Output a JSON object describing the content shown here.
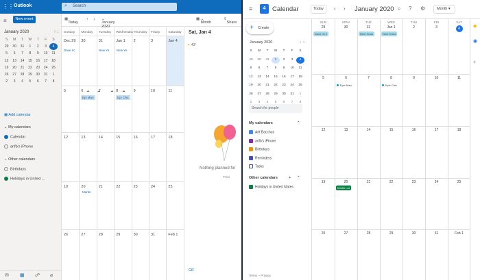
{
  "outlook": {
    "brand": "Outlook",
    "search_placeholder": "Search",
    "new_event": "New event",
    "toolbar": {
      "today": "Today",
      "month_label": "January 2020",
      "view": "Month",
      "share": "Share"
    },
    "mini_month": "January 2020",
    "mini_dow": [
      "S",
      "M",
      "T",
      "W",
      "T",
      "F",
      "S"
    ],
    "mini_weeks": [
      [
        "29",
        "30",
        "31",
        "1",
        "2",
        "3",
        "4"
      ],
      [
        "5",
        "6",
        "7",
        "8",
        "9",
        "10",
        "11"
      ],
      [
        "12",
        "13",
        "14",
        "15",
        "16",
        "17",
        "18"
      ],
      [
        "19",
        "20",
        "21",
        "22",
        "23",
        "24",
        "25"
      ],
      [
        "26",
        "27",
        "28",
        "29",
        "30",
        "31",
        "1"
      ],
      [
        "2",
        "3",
        "4",
        "5",
        "6",
        "7",
        "8"
      ]
    ],
    "add_calendar": "Add calendar",
    "my_calendars": "My calendars",
    "my_items": [
      "Calendar",
      "arifb's iPhone"
    ],
    "other_calendars": "Other calendars",
    "other_items": [
      "Birthdays",
      "Holidays in United ..."
    ],
    "grid_dow": [
      "Sunday",
      "Monday",
      "Tuesday",
      "Wednesday",
      "Thursday",
      "Friday",
      "Saturday"
    ],
    "week_rows": [
      [
        "Dec 29",
        "30",
        "31",
        "Jan 1",
        "2",
        "3",
        "Jan 4"
      ],
      [
        "5",
        "6",
        "7",
        "8",
        "9",
        "10",
        "11"
      ],
      [
        "12",
        "13",
        "14",
        "15",
        "16",
        "17",
        "18"
      ],
      [
        "19",
        "20",
        "21",
        "22",
        "23",
        "24",
        "25"
      ],
      [
        "26",
        "27",
        "28",
        "29",
        "30",
        "31",
        "Feb 1"
      ]
    ],
    "events": {
      "dave": "Dave ric",
      "newyear_tue": "New Ye",
      "newyear_wed": "New Ye",
      "epi_mon": "Epi Man",
      "epi_wed": "Epi Chic",
      "martin": "Martin"
    },
    "agenda": {
      "title": "Sat, Jan 4",
      "weather": "43°",
      "nothing": "Nothing planned for",
      "prev": "Previ",
      "gif": "GIF"
    }
  },
  "gcal": {
    "title": "Calendar",
    "logo_num": "4",
    "today": "Today",
    "month_title": "January 2020",
    "view": "Month",
    "create": "Create",
    "mini_month": "January 2020",
    "mini_dow": [
      "S",
      "M",
      "T",
      "W",
      "T",
      "F",
      "S"
    ],
    "mini_weeks": [
      [
        "29",
        "30",
        "31",
        "1",
        "2",
        "3",
        "4"
      ],
      [
        "5",
        "6",
        "7",
        "8",
        "9",
        "10",
        "11"
      ],
      [
        "12",
        "13",
        "14",
        "15",
        "16",
        "17",
        "18"
      ],
      [
        "19",
        "20",
        "21",
        "22",
        "23",
        "24",
        "25"
      ],
      [
        "26",
        "27",
        "28",
        "29",
        "30",
        "31",
        "1"
      ],
      [
        "2",
        "3",
        "4",
        "5",
        "6",
        "7",
        "8"
      ]
    ],
    "search_people": "Search for people",
    "my_calendars": "My calendars",
    "my_items": [
      {
        "label": "Arif Bacchus",
        "color": "#4285f4"
      },
      {
        "label": "arifb's iPhone",
        "color": "#8e24aa"
      },
      {
        "label": "Birthdays",
        "color": "#f09300"
      },
      {
        "label": "Reminders",
        "color": "#3f51b5"
      },
      {
        "label": "Tasks",
        "color": "#ffffff"
      }
    ],
    "other_calendars": "Other calendars",
    "other_items": [
      {
        "label": "Holidays in United States",
        "color": "#0b8043"
      }
    ],
    "footer": "Terms – Privacy",
    "dow": [
      "SUN",
      "MON",
      "TUE",
      "WED",
      "THU",
      "FRI",
      "SAT"
    ],
    "week_rows": [
      [
        "29",
        "30",
        "31",
        "Jan 1",
        "2",
        "3",
        "4"
      ],
      [
        "5",
        "6",
        "7",
        "8",
        "9",
        "10",
        "11"
      ],
      [
        "12",
        "13",
        "14",
        "15",
        "16",
        "17",
        "18"
      ],
      [
        "19",
        "20",
        "21",
        "22",
        "23",
        "24",
        "25"
      ],
      [
        "26",
        "27",
        "28",
        "29",
        "30",
        "31",
        "Feb 1"
      ]
    ],
    "events": {
      "dave": "Dave ric b",
      "ny1": "New Years",
      "ny2": "New Years",
      "epi_mon": "Epic Man",
      "epi_wed": "Epic Chic",
      "mlk": "Martin Lut"
    },
    "colors": {
      "accent": "#1a73e8",
      "holiday": "#0b8043",
      "outlook_blue": "#0f6cbd"
    }
  }
}
